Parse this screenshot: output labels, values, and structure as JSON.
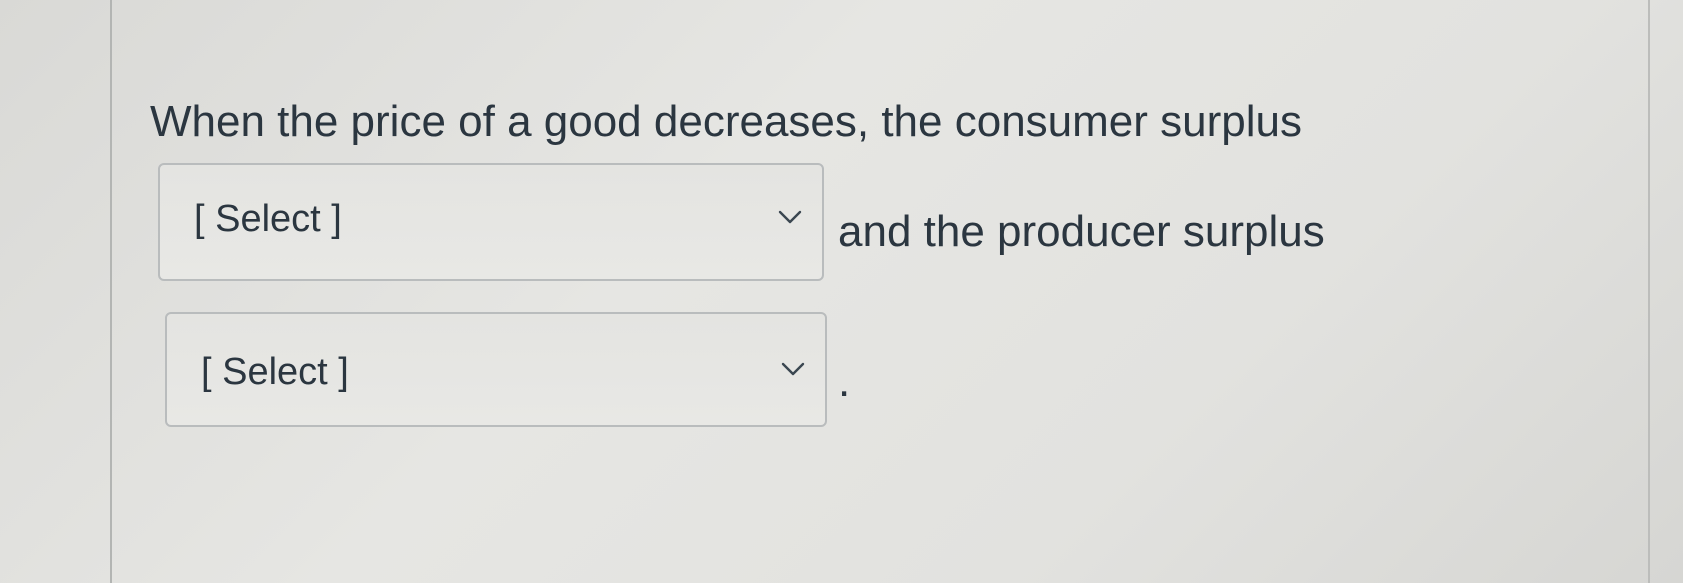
{
  "question": {
    "lead_text": "When the price of a good decreases, the consumer surplus",
    "middle_text": "and the producer surplus",
    "end_text": "."
  },
  "dropdowns": [
    {
      "selected": "[ Select ]",
      "icon": "chevron-down-icon"
    },
    {
      "selected": "[ Select ]",
      "icon": "chevron-down-icon"
    }
  ],
  "colors": {
    "text": "#2b3640",
    "border": "#b9bcbd",
    "background": "#e2e2df"
  }
}
